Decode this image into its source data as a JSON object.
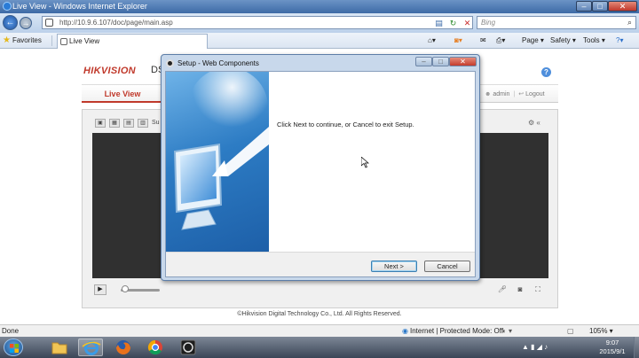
{
  "browser": {
    "window_title": "Live View - Windows Internet Explorer",
    "url": "http://10.9.6.107/doc/page/main.asp",
    "search_placeholder": "Bing",
    "favorites_label": "Favorites",
    "tab_title": "Live View",
    "commands": {
      "page": "Page ▾",
      "safety": "Safety ▾",
      "tools": "Tools ▾"
    },
    "status": {
      "done": "Done",
      "zone": "Internet | Protected Mode: Off",
      "zoom": "105% ▾"
    }
  },
  "webpage": {
    "logo": "HIKVISION",
    "logo_suffix": "DS",
    "nav_live_view": "Live View",
    "user": "admin",
    "logout": "Logout",
    "toolbar_label": "Su",
    "copyright": "©Hikvision Digital Technology Co., Ltd. All Rights Reserved."
  },
  "dialog": {
    "title": "Setup - Web Components",
    "message": "Click Next to continue, or Cancel to exit Setup.",
    "next_label": "Next >",
    "cancel_label": "Cancel"
  },
  "taskbar": {
    "time": "9:07",
    "date": "2015/9/1"
  },
  "colors": {
    "hikvision_red": "#c0392b",
    "ie_titlebar": "#3d6aa6",
    "dialog_banner": "#2d7cc4"
  },
  "icons": [
    "ie-logo-icon",
    "back-icon",
    "forward-icon",
    "refresh-icon",
    "stop-icon",
    "search-icon",
    "star-icon",
    "home-icon",
    "feeds-icon",
    "mail-icon",
    "print-icon",
    "help-icon",
    "user-icon",
    "logout-icon",
    "play-icon",
    "mic-icon",
    "snapshot-icon",
    "fullscreen-icon",
    "globe-icon",
    "start-icon",
    "folder-icon",
    "firefox-icon",
    "chrome-icon",
    "obs-icon"
  ]
}
